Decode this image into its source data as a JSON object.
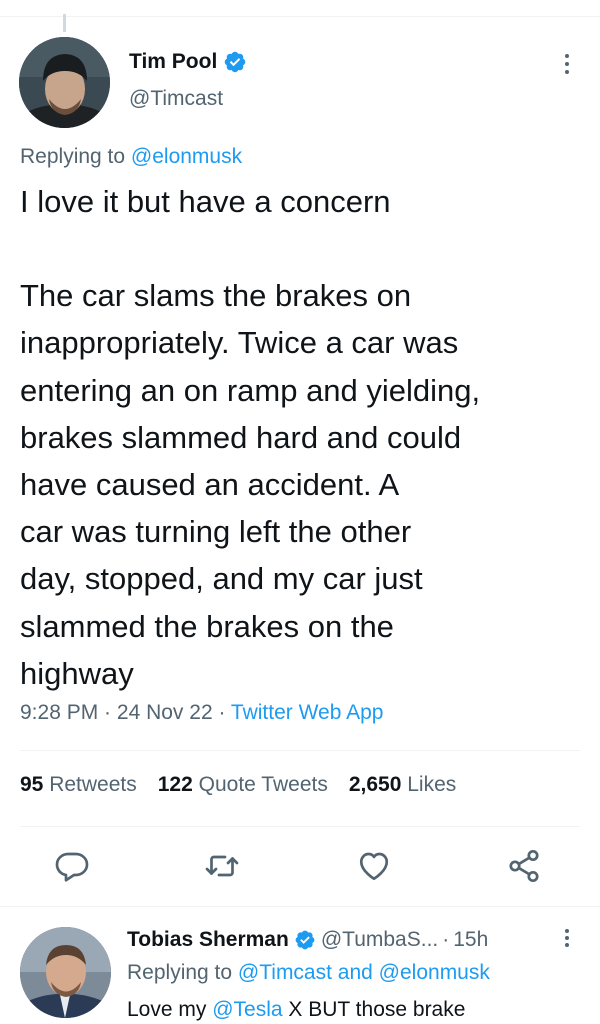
{
  "tweet": {
    "author": {
      "display_name": "Tim Pool",
      "handle": "@Timcast",
      "verified": true
    },
    "replying_to_prefix": "Replying to ",
    "replying_to": "@elonmusk",
    "text_lines": [
      "I love it but have a concern",
      "",
      "The car slams the brakes on",
      "inappropriately. Twice a car was",
      "entering an on ramp and yielding,",
      "brakes slammed hard and could",
      "have caused an accident. A",
      "car was turning left the other",
      "day, stopped, and my car just",
      "slammed the brakes on the",
      "highway"
    ],
    "time": "9:28 PM",
    "date": "24 Nov 22",
    "separator": " · ",
    "source": "Twitter Web App",
    "stats": {
      "retweets_count": "95",
      "retweets_label": "Retweets",
      "quotes_count": "122",
      "quotes_label": "Quote Tweets",
      "likes_count": "2,650",
      "likes_label": "Likes"
    }
  },
  "reply": {
    "display_name": "Tobias Sherman",
    "handle": "@TumbaS...",
    "separator": "·",
    "time": "15h",
    "replying_to_prefix": "Replying to ",
    "replying_to_1": "@Timcast",
    "and": " and ",
    "replying_to_2": "@elonmusk",
    "text_prefix": "Love my ",
    "text_mention": "@Tesla",
    "text_suffix": " X BUT those brake"
  },
  "icons": {
    "verified": "verified-badge-icon",
    "more": "more-vertical-icon",
    "reply": "reply-icon",
    "retweet": "retweet-icon",
    "like": "heart-icon",
    "share": "share-icon"
  },
  "colors": {
    "accent": "#1d9bf0",
    "secondary_text": "#536471",
    "primary_text": "#0f1419"
  }
}
